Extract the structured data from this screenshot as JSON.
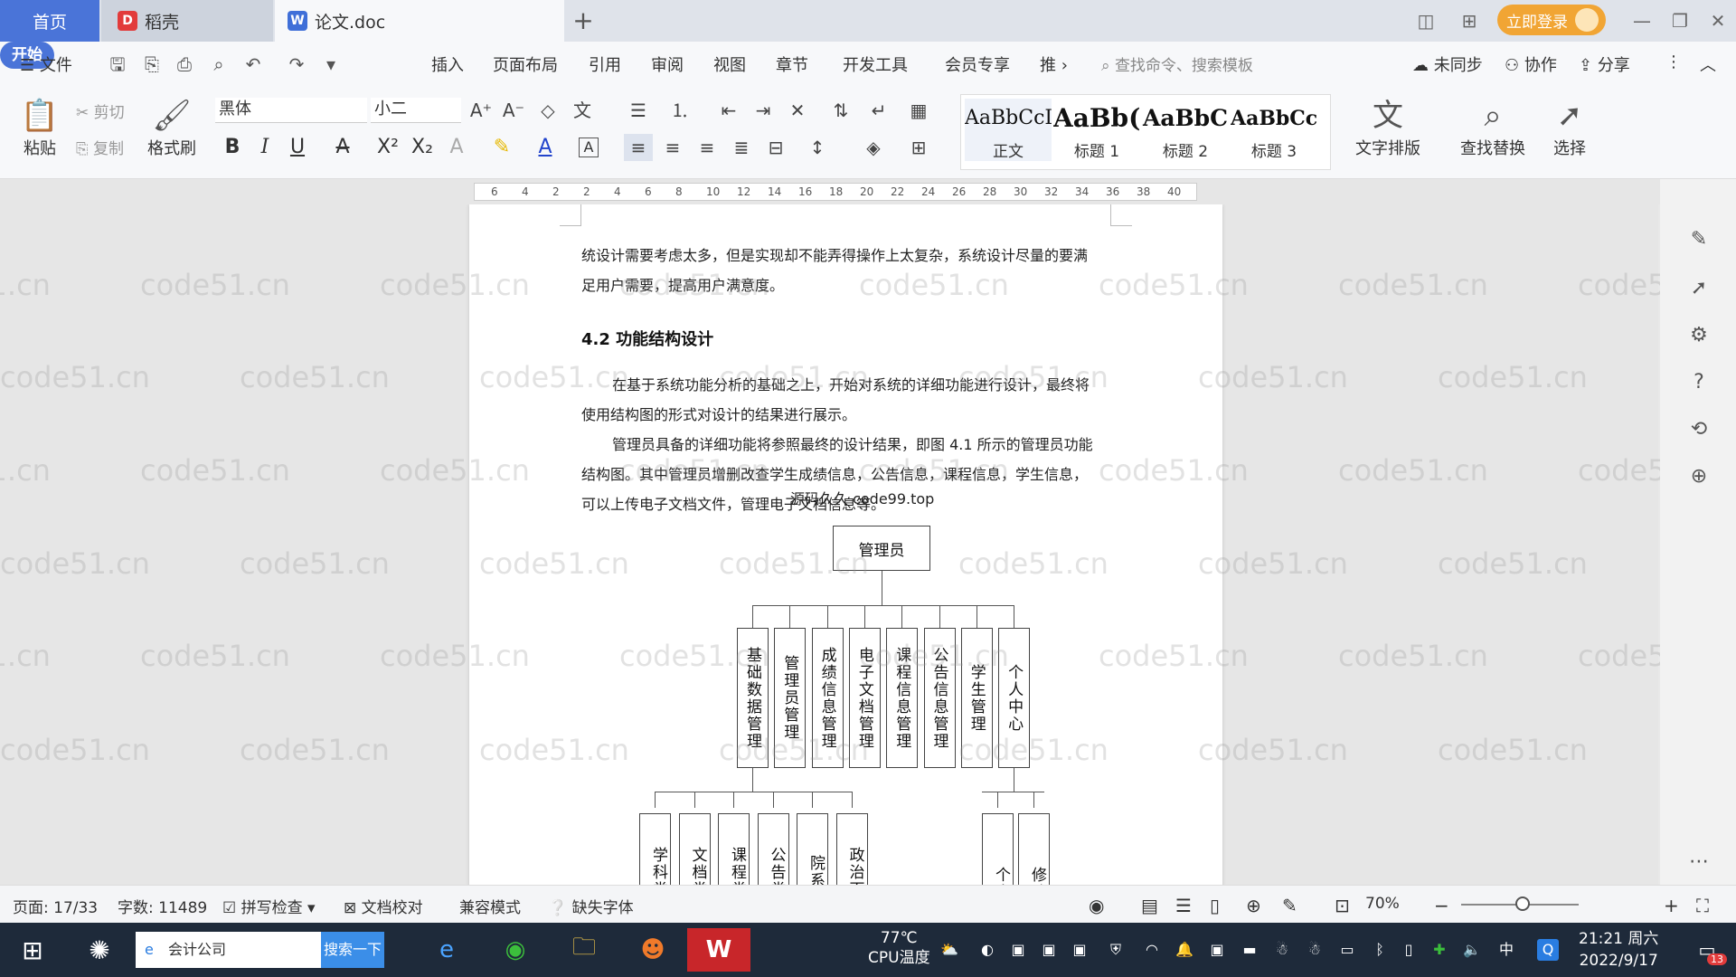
{
  "tabs": {
    "home": "首页",
    "daoke": "稻壳",
    "doc": "论文.doc"
  },
  "titlebar": {
    "login": "立即登录"
  },
  "menu": {
    "file": "文件",
    "items": [
      "开始",
      "插入",
      "页面布局",
      "引用",
      "审阅",
      "视图",
      "章节",
      "开发工具",
      "会员专享",
      "推"
    ],
    "search_command": "查找命令、搜索模板",
    "sync": "未同步",
    "collab": "协作",
    "share": "分享"
  },
  "ribbon": {
    "paste": "粘贴",
    "cut": "剪切",
    "copy": "复制",
    "format_painter": "格式刷",
    "font_name": "黑体",
    "font_size": "小二",
    "styles": [
      {
        "sample": "AaBbCcI",
        "name": "正文"
      },
      {
        "sample": "AaBb(",
        "name": "标题 1"
      },
      {
        "sample": "AaBbC",
        "name": "标题 2"
      },
      {
        "sample": "AaBbCc",
        "name": "标题 3"
      }
    ],
    "text_layout": "文字排版",
    "find_replace": "查找替换",
    "select": "选择"
  },
  "ruler": {
    "numbers": [
      "6",
      "4",
      "2",
      "2",
      "4",
      "6",
      "8",
      "10",
      "12",
      "14",
      "16",
      "18",
      "20",
      "22",
      "24",
      "26",
      "28",
      "30",
      "32",
      "34",
      "36",
      "38",
      "40"
    ]
  },
  "document": {
    "para1_line1": "统设计需要考虑太多，但是实现却不能弄得操作上太复杂，系统设计尽量的要满",
    "para1_line2": "足用户需要，提高用户满意度。",
    "heading": "4.2  功能结构设计",
    "para2_line1": "在基于系统功能分析的基础之上，开始对系统的详细功能进行设计，最终将",
    "para2_line2": "使用结构图的形式对设计的结果进行展示。",
    "para3_line1": "管理员具备的详细功能将参照最终的设计结果，即图 4.1 所示的管理员功能",
    "para3_line2": "结构图。其中管理员增删改查学生成绩信息，公告信息，课程信息，学生信息，",
    "para3_line3": "可以上传电子文档文件，管理电子文档信息等。",
    "overlay_watermark": "源码久久 code99.top",
    "watermark": "code51.cn"
  },
  "org_chart": {
    "root": "管理员",
    "level1": [
      "基础数据管理",
      "管理员管理",
      "成绩信息管理",
      "电子文档管理",
      "课程信息管理",
      "公告信息管理",
      "学生管理",
      "个人中心"
    ],
    "level2_left": [
      "学科类",
      "文档类",
      "课程类",
      "公告类",
      "院系",
      "政治面"
    ],
    "level2_right": [
      "个人",
      "修改"
    ]
  },
  "statusbar": {
    "page": "页面: 17/33",
    "words": "字数: 11489",
    "spell": "拼写检查",
    "proof": "文档校对",
    "compat": "兼容模式",
    "missing_font": "缺失字体",
    "zoom": "70%"
  },
  "taskbar": {
    "search_text": "会计公司",
    "search_btn": "搜索一下",
    "temp": "77℃",
    "temp_label": "CPU温度",
    "ime": "中",
    "time": "21:21 周六",
    "date": "2022/9/17",
    "notif_count": "13"
  }
}
